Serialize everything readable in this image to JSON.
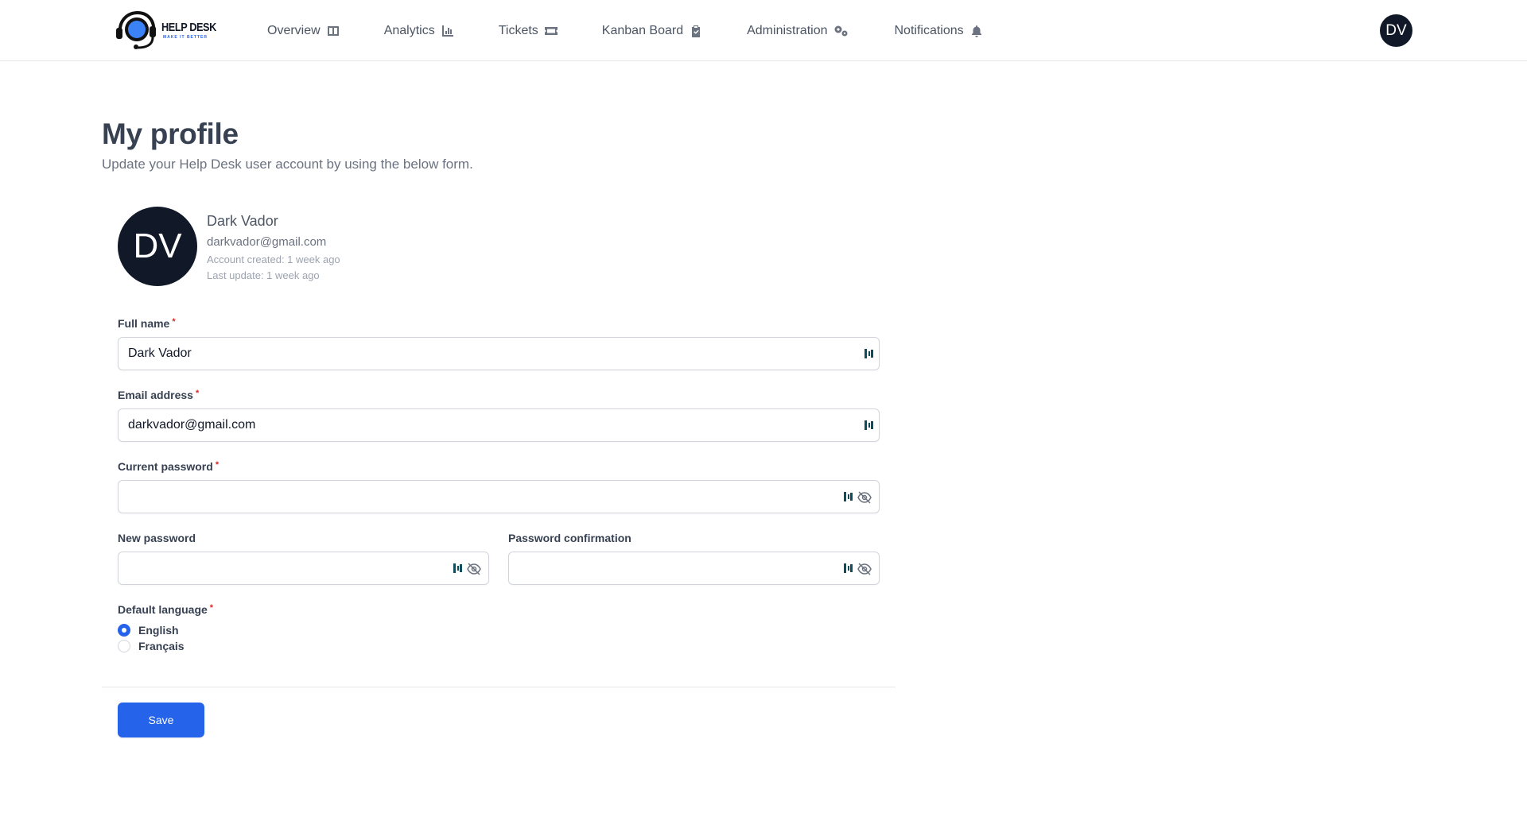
{
  "brand": {
    "title": "HELP DESK",
    "tagline": "MAKE IT BETTER",
    "accent_color": "#2563eb"
  },
  "nav": {
    "items": [
      {
        "label": "Overview",
        "icon": "layout-columns-icon"
      },
      {
        "label": "Analytics",
        "icon": "bar-chart-icon"
      },
      {
        "label": "Tickets",
        "icon": "ticket-icon"
      },
      {
        "label": "Kanban Board",
        "icon": "clipboard-check-icon"
      },
      {
        "label": "Administration",
        "icon": "gears-icon"
      },
      {
        "label": "Notifications",
        "icon": "bell-icon"
      }
    ],
    "user_initials": "DV"
  },
  "header": {
    "title": "My profile",
    "subtitle": "Update your Help Desk user account by using the below form."
  },
  "profile": {
    "initials": "DV",
    "name": "Dark Vador",
    "email": "darkvador@gmail.com",
    "created": "Account created: 1 week ago",
    "updated": "Last update: 1 week ago"
  },
  "form": {
    "full_name": {
      "label": "Full name",
      "required": "*",
      "value": "Dark Vador"
    },
    "email": {
      "label": "Email address",
      "required": "*",
      "value": "darkvador@gmail.com"
    },
    "current_password": {
      "label": "Current password",
      "required": "*",
      "value": ""
    },
    "new_password": {
      "label": "New password",
      "value": ""
    },
    "password_confirmation": {
      "label": "Password confirmation",
      "value": ""
    },
    "language": {
      "label": "Default language",
      "required": "*",
      "options": [
        {
          "label": "English",
          "selected": true
        },
        {
          "label": "Français",
          "selected": false
        }
      ]
    },
    "save_label": "Save"
  }
}
